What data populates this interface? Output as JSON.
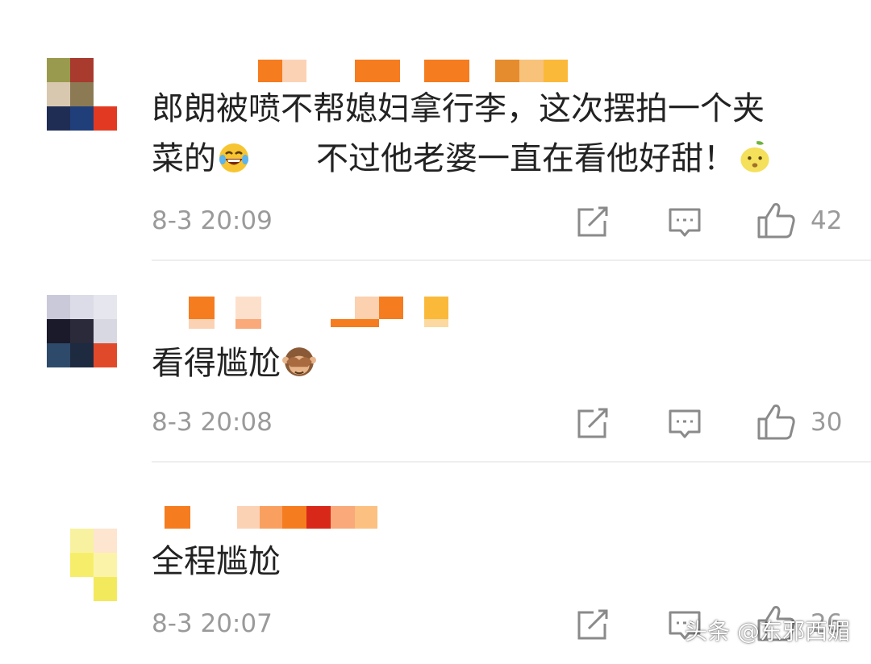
{
  "comments": [
    {
      "text_line1": "郎朗被喷不帮媳妇拿行李，这次摆拍一个夹",
      "text_line2_a": "菜的",
      "text_line2_b": "不过他老婆一直在看他好甜！",
      "emojis": [
        "laughing-crying-emoji",
        "pear-face-emoji"
      ],
      "time": "8-3 20:09",
      "likes": "42"
    },
    {
      "text": "看得尴尬",
      "emojis": [
        "see-no-evil-monkey-emoji"
      ],
      "time": "8-3 20:08",
      "likes": "30"
    },
    {
      "text": "全程尴尬",
      "time": "8-3 20:07",
      "likes": "26"
    }
  ],
  "watermark": "头条 @东邪西媚",
  "colors": {
    "text": "#222222",
    "meta": "#9a9a9a",
    "icon": "#8a8a8a",
    "mosaic_orange": "#f57c1f"
  }
}
